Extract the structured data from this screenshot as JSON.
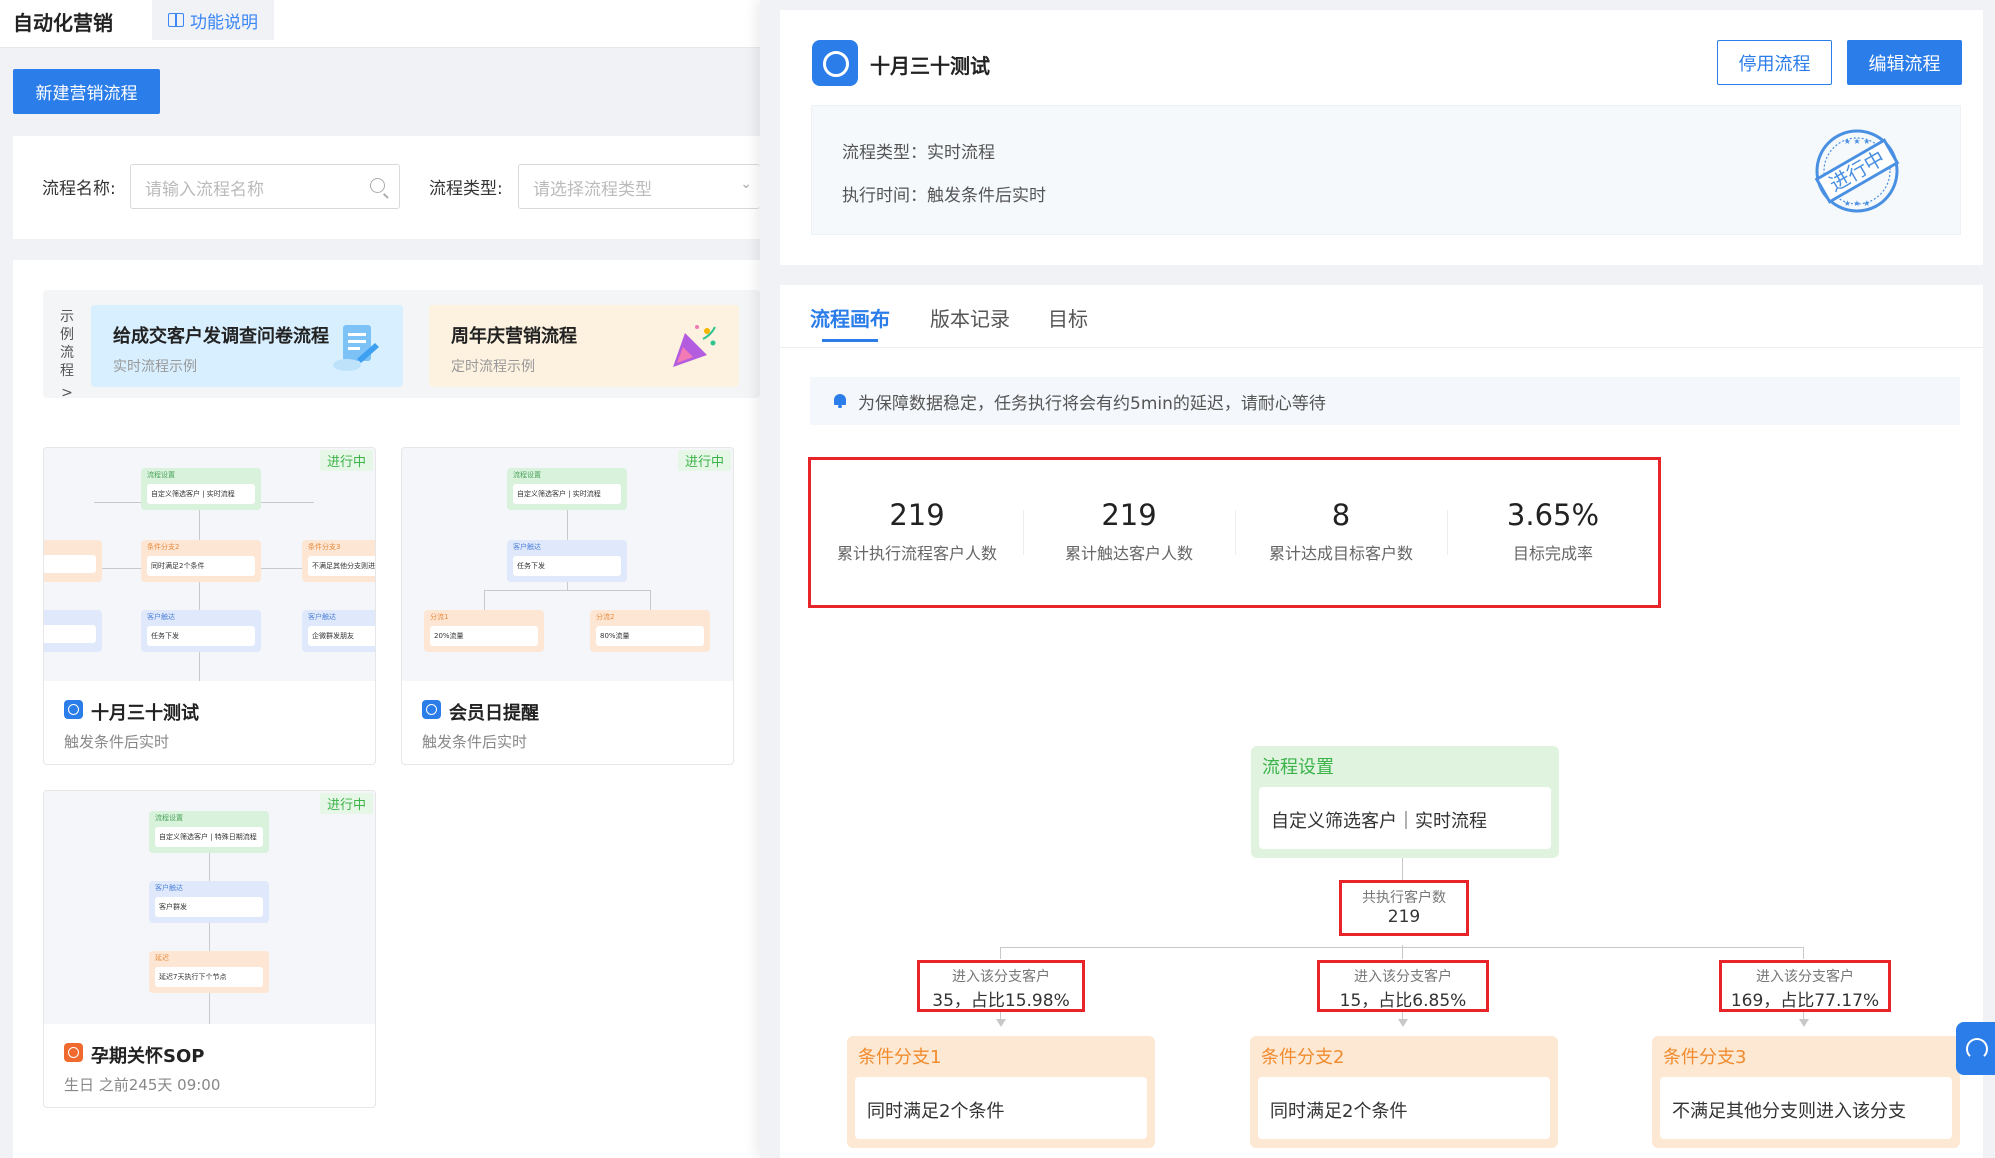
{
  "header": {
    "app_title": "自动化营销",
    "func_label": "功能说明"
  },
  "toolbar": {
    "new_flow_label": "新建营销流程"
  },
  "filter": {
    "name_label": "流程名称:",
    "name_placeholder": "请输入流程名称",
    "type_label": "流程类型:",
    "type_placeholder": "请选择流程类型"
  },
  "examples": {
    "side_label": [
      "示",
      "例",
      "流",
      "程"
    ],
    "side_arrow": ">",
    "items": [
      {
        "title": "给成交客户发调查问卷流程",
        "subtitle": "实时流程示例"
      },
      {
        "title": "周年庆营销流程",
        "subtitle": "定时流程示例"
      }
    ]
  },
  "flows": [
    {
      "badge": "进行中",
      "name": "十月三十测试",
      "subtitle": "触发条件后实时",
      "thumb": {
        "n1_title": "流程设置",
        "n1_text": "自定义筛选客户 | 实时流程",
        "n2_title": "条件分支2",
        "n2_text": "同时满足2个条件",
        "n3_title": "条件分支3",
        "n3_text": "不满足其他分支则进",
        "n4_title": "客户触达",
        "n4_text": "任务下发",
        "n5_title": "客户触达",
        "n5_text": "企微群发朋友"
      }
    },
    {
      "badge": "进行中",
      "name": "会员日提醒",
      "subtitle": "触发条件后实时",
      "thumb": {
        "n1_title": "流程设置",
        "n1_text": "自定义筛选客户 | 实时流程",
        "n2_title": "客户触达",
        "n2_text": "任务下发",
        "n3_title": "分流1",
        "n3_text": "20%流量",
        "n4_title": "分流2",
        "n4_text": "80%流量"
      }
    },
    {
      "badge": "进行中",
      "name": "孕期关怀SOP",
      "subtitle": "生日 之前245天 09:00",
      "thumb": {
        "n1_title": "流程设置",
        "n1_text": "自定义筛选客户 | 特殊日期流程",
        "n2_title": "客户触达",
        "n2_text": "客户群发",
        "n3_title": "延迟",
        "n3_text": "延迟7天执行下个节点"
      }
    }
  ],
  "detail": {
    "title": "十月三十测试",
    "stop_label": "停用流程",
    "edit_label": "编辑流程",
    "type_line": "流程类型：实时流程",
    "time_line": "执行时间：触发条件后实时",
    "stamp_text": "进行中",
    "tabs": [
      "流程画布",
      "版本记录",
      "目标"
    ],
    "notice": "为保障数据稳定，任务执行将会有约5min的延迟，请耐心等待",
    "stats": [
      {
        "value": "219",
        "label": "累计执行流程客户人数"
      },
      {
        "value": "219",
        "label": "累计触达客户人数"
      },
      {
        "value": "8",
        "label": "累计达成目标客户数"
      },
      {
        "value": "3.65%",
        "label": "目标完成率"
      }
    ],
    "canvas": {
      "setting_title": "流程设置",
      "setting_text": "自定义筛选客户｜实时流程",
      "total_label": "共执行客户数",
      "total_value": "219",
      "branches": [
        {
          "enter_label": "进入该分支客户",
          "enter_value": "35，占比15.98%",
          "title": "条件分支1",
          "text": "同时满足2个条件"
        },
        {
          "enter_label": "进入该分支客户",
          "enter_value": "15，占比6.85%",
          "title": "条件分支2",
          "text": "同时满足2个条件"
        },
        {
          "enter_label": "进入该分支客户",
          "enter_value": "169，占比77.17%",
          "title": "条件分支3",
          "text": "不满足其他分支则进入该分支"
        }
      ]
    }
  },
  "colors": {
    "primary": "#2b7de9",
    "highlight_red": "#e8242b",
    "running_green": "#3bb34a",
    "branch_orange": "#f08c2f"
  }
}
